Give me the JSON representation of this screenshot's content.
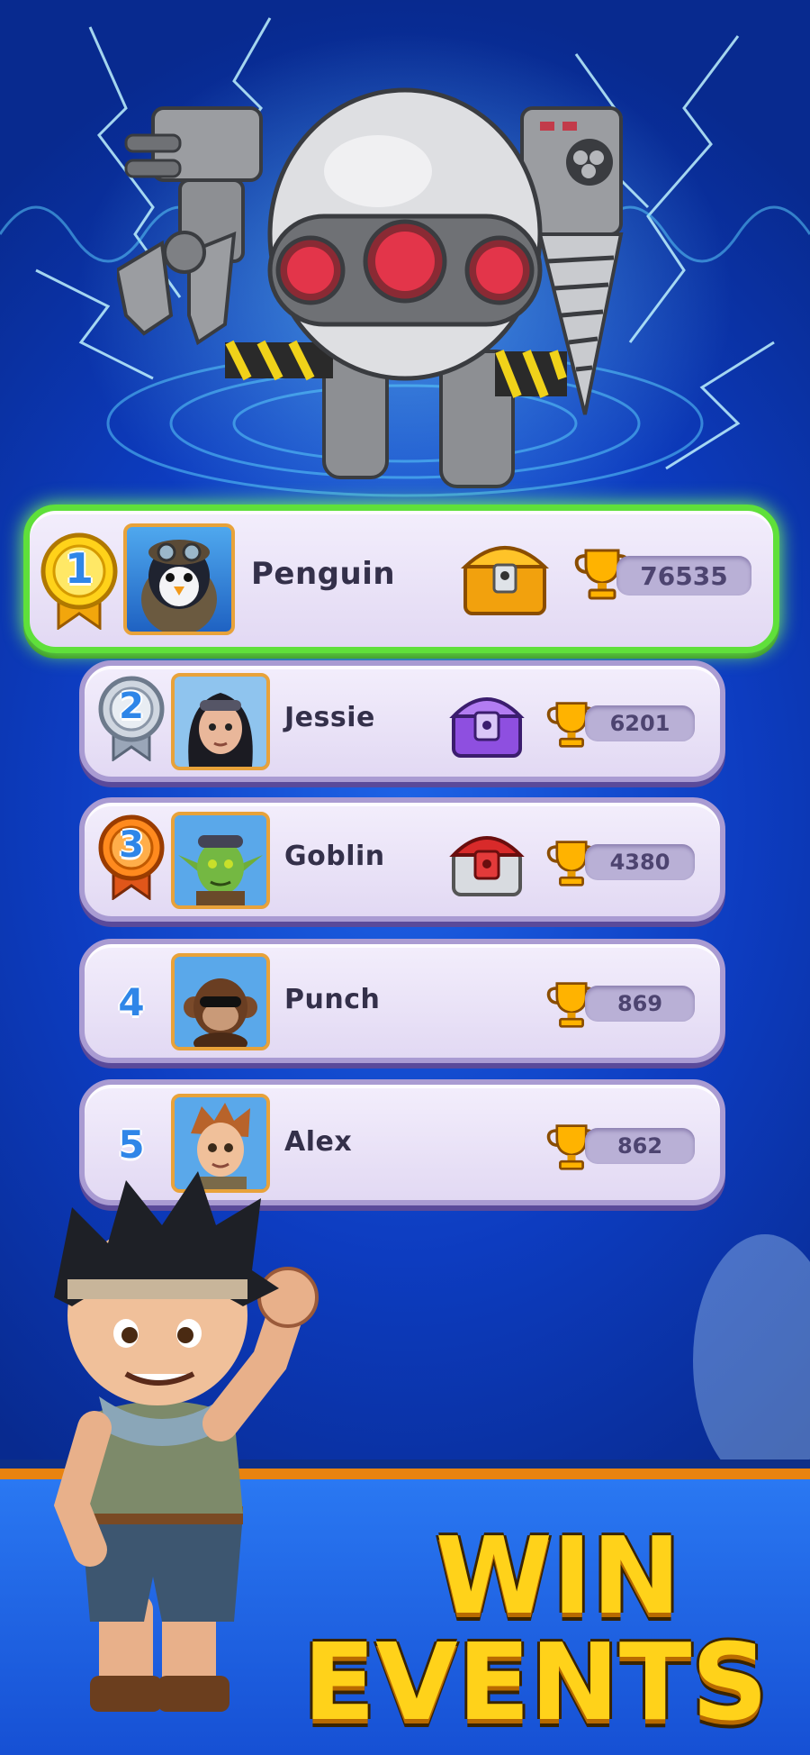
{
  "leaderboard": [
    {
      "rank": "1",
      "name": "Penguin",
      "score": "76535",
      "medal": "gold",
      "chest": "gold-chest-icon",
      "avatar": "penguin-avatar"
    },
    {
      "rank": "2",
      "name": "Jessie",
      "score": "6201",
      "medal": "silver",
      "chest": "purple-chest-icon",
      "avatar": "jessie-avatar"
    },
    {
      "rank": "3",
      "name": "Goblin",
      "score": "4380",
      "medal": "bronze",
      "chest": "red-chest-icon",
      "avatar": "goblin-avatar"
    },
    {
      "rank": "4",
      "name": "Punch",
      "score": "869",
      "medal": "",
      "chest": "",
      "avatar": "monkey-avatar"
    },
    {
      "rank": "5",
      "name": "Alex",
      "score": "862",
      "medal": "",
      "chest": "",
      "avatar": "alex-avatar"
    }
  ],
  "banner": {
    "line1": "WIN",
    "line2": "EVENTS"
  },
  "colors": {
    "gold": "#ffd21a",
    "highlight": "#5fe03a",
    "row_bg": "#ebe4f7",
    "banner_bg": "#1f63e6"
  }
}
